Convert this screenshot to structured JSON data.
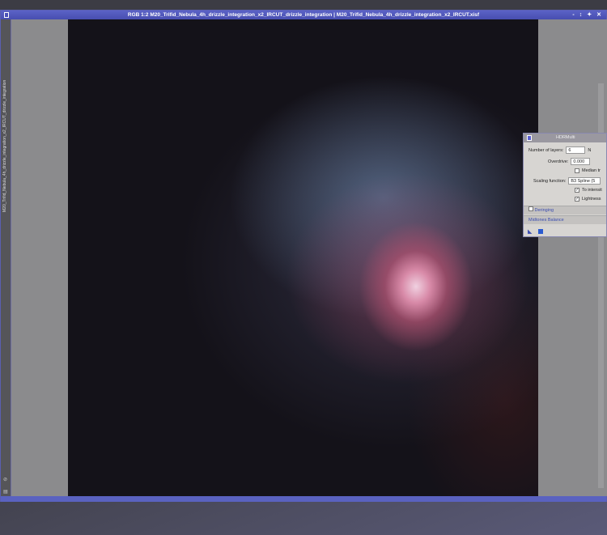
{
  "window": {
    "title": "RGB 1:2 M20_Trifid_Nebula_4h_drizzle_integration_x2_IRCUT_drizzle_integration | M20_Trifid_Nebula_4h_drizzle_integration_x2_IRCUT.xisf",
    "controls": [
      "-",
      "↕",
      "✦",
      "✕"
    ],
    "side_tab": "M20_Trifid_Nebula_4h_drizzle_integration_x2_IRCUT_drizzle_integration"
  },
  "dialog": {
    "title": "HDRMulti",
    "number_of_layers_label": "Number of layers:",
    "number_of_layers": "6",
    "extra_label": "N",
    "overdrive_label": "Overdrive:",
    "overdrive": "0.000",
    "median_label": "Median tr",
    "scaling_label": "Scaling function:",
    "scaling_value": "B3 Spline (5",
    "to_intensity_label": "To intensit",
    "lightness_label": "Lightness",
    "deringing_label": "Deringing",
    "midtones_label": "Midtones Balance"
  }
}
